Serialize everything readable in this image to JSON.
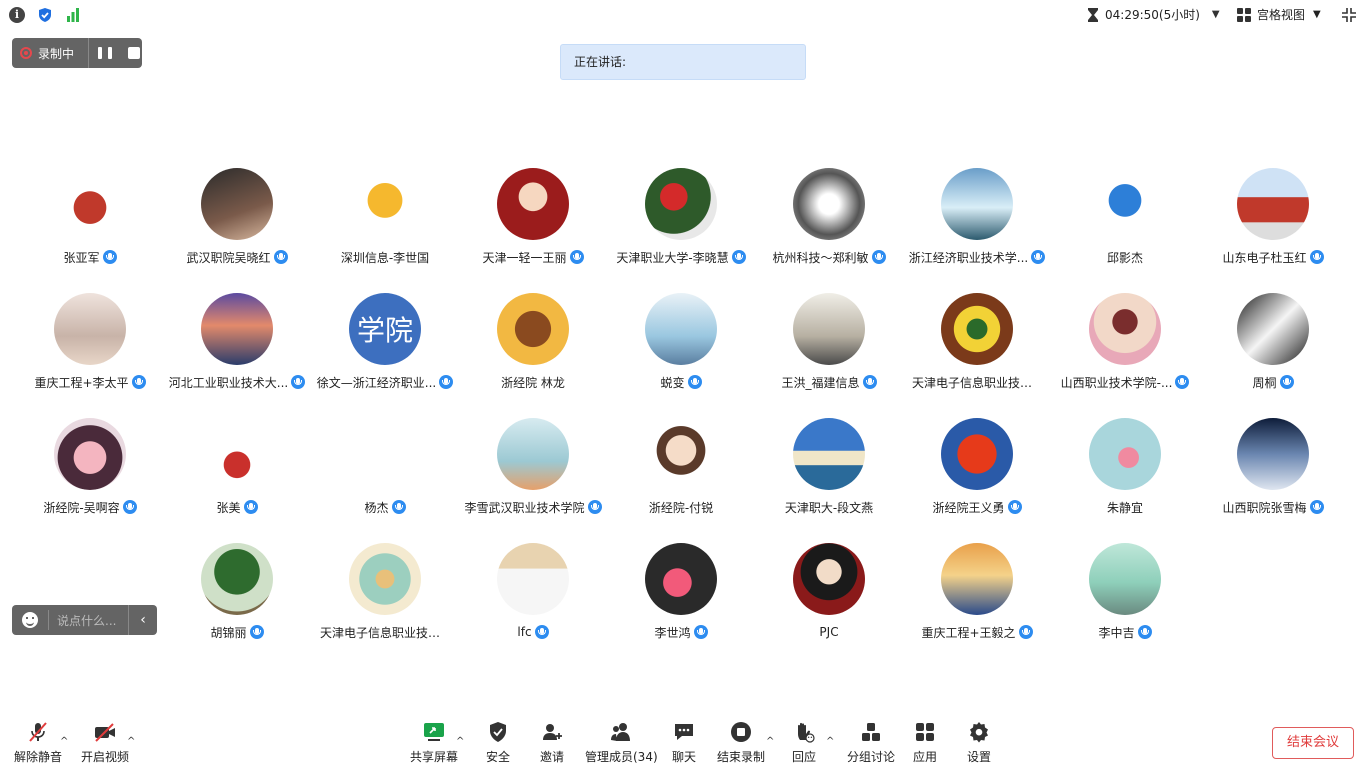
{
  "topbar": {
    "timer": "04:29:50(5小时)",
    "view_label": "宫格视图"
  },
  "recording": {
    "label": "录制中"
  },
  "speaking": {
    "label": "正在讲话:"
  },
  "participants": [
    {
      "name": "张亚军",
      "mic": true
    },
    {
      "name": "武汉职院吴晓红",
      "mic": true
    },
    {
      "name": "深圳信息-李世国",
      "mic": false
    },
    {
      "name": "天津一轻一王丽",
      "mic": true
    },
    {
      "name": "天津职业大学-李晓慧",
      "mic": true
    },
    {
      "name": "杭州科技～郑利敏",
      "mic": true
    },
    {
      "name": "浙江经济职业技术学...",
      "mic": true
    },
    {
      "name": "邱影杰",
      "mic": false
    },
    {
      "name": "山东电子杜玉红",
      "mic": true
    },
    {
      "name": "重庆工程+李太平",
      "mic": true
    },
    {
      "name": "河北工业职业技术大...",
      "mic": true
    },
    {
      "name": "徐文—浙江经济职业...",
      "mic": true,
      "avatar_text": "学院"
    },
    {
      "name": "浙经院 林龙",
      "mic": false
    },
    {
      "name": "蜕变",
      "mic": true
    },
    {
      "name": "王洪_福建信息",
      "mic": true
    },
    {
      "name": "天津电子信息职业技术...",
      "mic": false
    },
    {
      "name": "山西职业技术学院-...",
      "mic": true
    },
    {
      "name": "周桐",
      "mic": true
    },
    {
      "name": "浙经院-吴啊容",
      "mic": true
    },
    {
      "name": "张美",
      "mic": true
    },
    {
      "name": "杨杰",
      "mic": true
    },
    {
      "name": "李雪武汉职业技术学院",
      "mic": true
    },
    {
      "name": "浙经院-付锐",
      "mic": false
    },
    {
      "name": "天津职大-段文燕",
      "mic": false
    },
    {
      "name": "浙经院王义勇",
      "mic": true
    },
    {
      "name": "朱静宜",
      "mic": false
    },
    {
      "name": "山西职院张雪梅",
      "mic": true
    },
    {
      "name": "胡锦丽",
      "mic": true
    },
    {
      "name": "天津电子信息职业技术...",
      "mic": false
    },
    {
      "name": "lfc",
      "mic": true
    },
    {
      "name": "李世鸿",
      "mic": true
    },
    {
      "name": "PJC",
      "mic": false
    },
    {
      "name": "重庆工程+王毅之",
      "mic": true
    },
    {
      "name": "李中吉",
      "mic": true
    }
  ],
  "chat": {
    "placeholder": "说点什么..."
  },
  "toolbar": {
    "unmute": "解除静音",
    "start_video": "开启视频",
    "share_screen": "共享屏幕",
    "security": "安全",
    "invite": "邀请",
    "manage_members": "管理成员(34)",
    "chat": "聊天",
    "end_recording": "结束录制",
    "reactions": "回应",
    "breakout": "分组讨论",
    "apps": "应用",
    "settings": "设置",
    "end_meeting": "结束会议"
  },
  "colors": {
    "accent_blue": "#2d8cf0",
    "danger_red": "#e03c3c",
    "pill_gray": "#646464",
    "speaking_bg": "#dbe9fb"
  }
}
